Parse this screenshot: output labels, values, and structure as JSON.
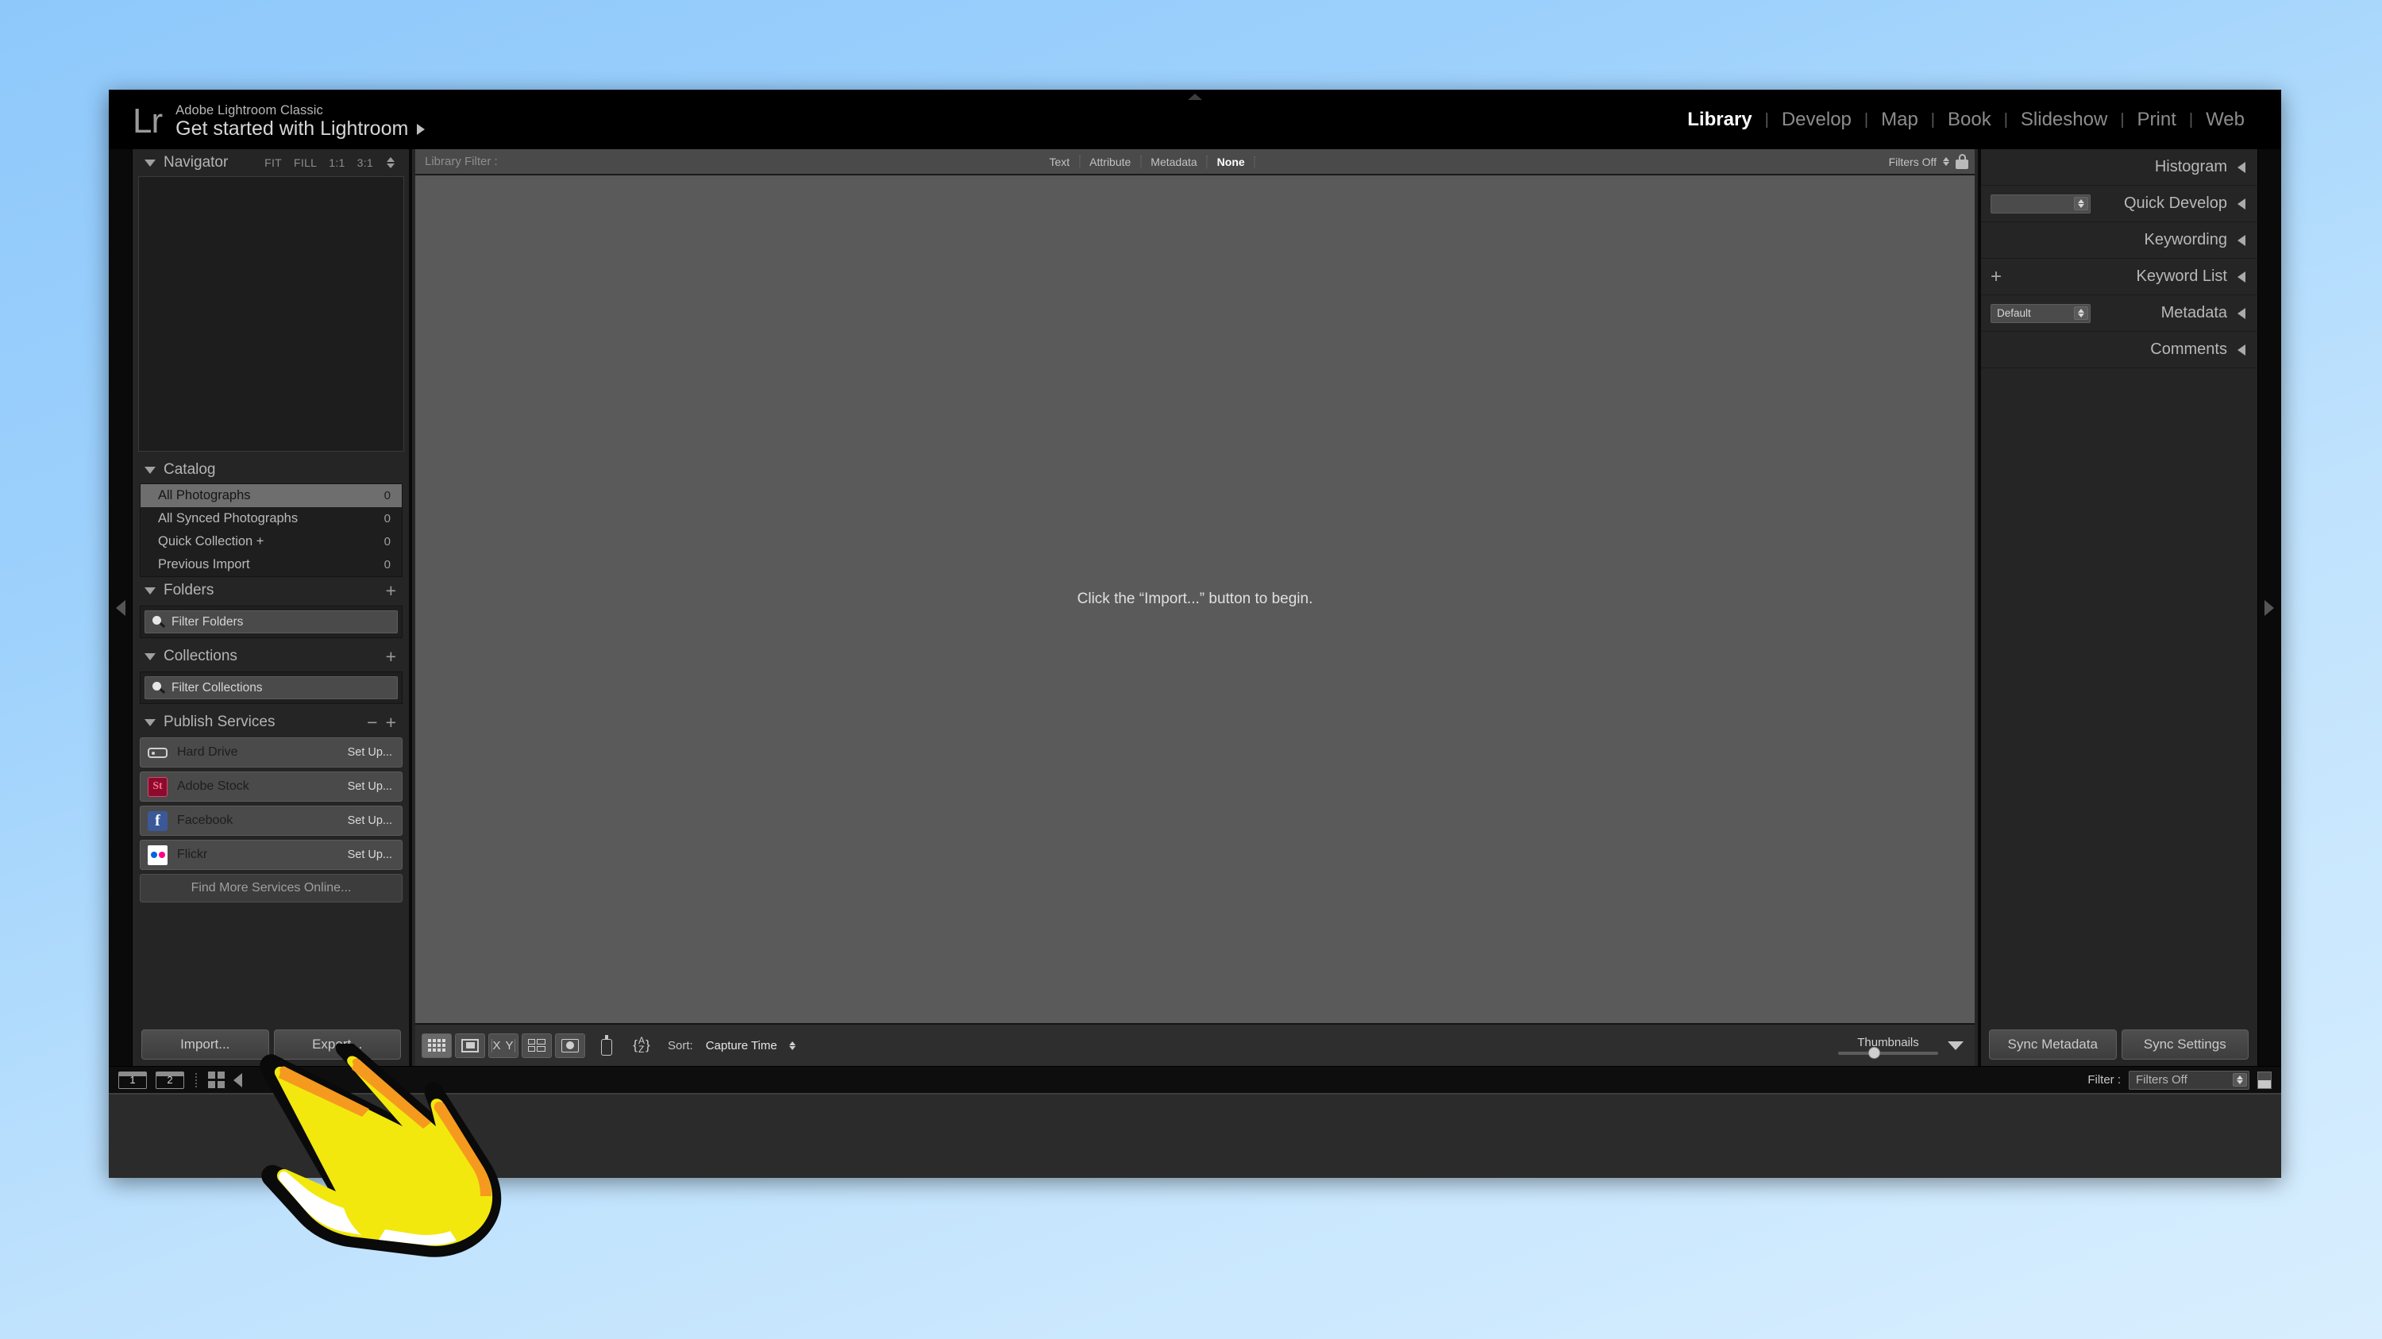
{
  "identity": {
    "logo": "Lr",
    "subtitle": "Adobe Lightroom Classic",
    "title": "Get started with Lightroom",
    "arrow_icon": "triangle-right-icon"
  },
  "module_picker": {
    "modules": [
      {
        "label": "Library",
        "active": true
      },
      {
        "label": "Develop",
        "active": false
      },
      {
        "label": "Map",
        "active": false
      },
      {
        "label": "Book",
        "active": false
      },
      {
        "label": "Slideshow",
        "active": false
      },
      {
        "label": "Print",
        "active": false
      },
      {
        "label": "Web",
        "active": false
      }
    ],
    "separator": "|"
  },
  "left_panel": {
    "navigator": {
      "title": "Navigator",
      "zoom_levels": [
        "FIT",
        "FILL",
        "1:1",
        "3:1"
      ]
    },
    "catalog": {
      "title": "Catalog",
      "items": [
        {
          "label": "All Photographs",
          "count": "0",
          "selected": true
        },
        {
          "label": "All Synced Photographs",
          "count": "0",
          "selected": false
        },
        {
          "label": "Quick Collection  +",
          "count": "0",
          "selected": false
        },
        {
          "label": "Previous Import",
          "count": "0",
          "selected": false
        }
      ]
    },
    "folders": {
      "title": "Folders",
      "add_label": "+",
      "filter_placeholder": "Filter Folders"
    },
    "collections": {
      "title": "Collections",
      "add_label": "+",
      "filter_placeholder": "Filter Collections"
    },
    "publish_services": {
      "title": "Publish Services",
      "minus_label": "−",
      "plus_label": "+",
      "services": [
        {
          "name": "Hard Drive",
          "action": "Set Up...",
          "icon": "hard-drive-icon"
        },
        {
          "name": "Adobe Stock",
          "action": "Set Up...",
          "icon": "adobe-stock-icon",
          "badge": "St"
        },
        {
          "name": "Facebook",
          "action": "Set Up...",
          "icon": "facebook-icon",
          "badge": "f"
        },
        {
          "name": "Flickr",
          "action": "Set Up...",
          "icon": "flickr-icon"
        }
      ],
      "find_more": "Find More Services Online..."
    },
    "buttons": {
      "import": "Import...",
      "export": "Export..."
    }
  },
  "library_filter": {
    "label": "Library Filter :",
    "modes": [
      {
        "label": "Text",
        "active": false
      },
      {
        "label": "Attribute",
        "active": false
      },
      {
        "label": "Metadata",
        "active": false
      },
      {
        "label": "None",
        "active": true
      }
    ],
    "filters_state": "Filters Off",
    "lock_icon": "lock-icon"
  },
  "content": {
    "message": "Click the “Import...” button to begin."
  },
  "toolbar": {
    "view_modes": [
      {
        "name": "grid-view-icon",
        "active": true
      },
      {
        "name": "loupe-view-icon",
        "active": false
      },
      {
        "name": "compare-view-icon",
        "active": false
      },
      {
        "name": "survey-view-icon",
        "active": false
      },
      {
        "name": "people-view-icon",
        "active": false
      }
    ],
    "spray_icon": "spray-can-icon",
    "az_icon": "sort-az-icon",
    "sort_label": "Sort:",
    "sort_value": "Capture Time",
    "thumbnails_label": "Thumbnails",
    "thumbnails_value": 33,
    "caret_icon": "chevron-down-icon"
  },
  "right_panel": {
    "sections": [
      {
        "title": "Histogram",
        "arrow_icon": "triangle-left-icon",
        "left_control": "none"
      },
      {
        "title": "Quick Develop",
        "arrow_icon": "triangle-left-icon",
        "left_control": "select",
        "select_value": ""
      },
      {
        "title": "Keywording",
        "arrow_icon": "triangle-left-icon",
        "left_control": "none"
      },
      {
        "title": "Keyword List",
        "arrow_icon": "triangle-left-icon",
        "left_control": "plus",
        "plus_label": "+"
      },
      {
        "title": "Metadata",
        "arrow_icon": "triangle-left-icon",
        "left_control": "select",
        "select_value": "Default"
      },
      {
        "title": "Comments",
        "arrow_icon": "triangle-left-icon",
        "left_control": "none"
      }
    ],
    "buttons": {
      "sync_metadata": "Sync Metadata",
      "sync_settings": "Sync Settings"
    }
  },
  "filmstrip": {
    "screen_buttons": [
      "1",
      "2"
    ],
    "grid_icon": "grid-icon",
    "back_arrow_icon": "triangle-left-icon",
    "filter_label": "Filter :",
    "filter_value": "Filters Off",
    "thumbnail_toggle_icon": "thumbnail-badge-icon"
  },
  "cursor": {
    "icon": "pointing-hand-cursor",
    "fill": "#f2e80d",
    "accent": "#f59a1f",
    "outline": "#000000"
  },
  "colors": {
    "window_bg": "#000000",
    "panel_bg": "#252525",
    "content_bg": "#5a5a5a",
    "desktop_gradient_start": "#8ec8fb",
    "desktop_gradient_end": "#d8eefe",
    "accent_selected": "#6e6e6e"
  }
}
